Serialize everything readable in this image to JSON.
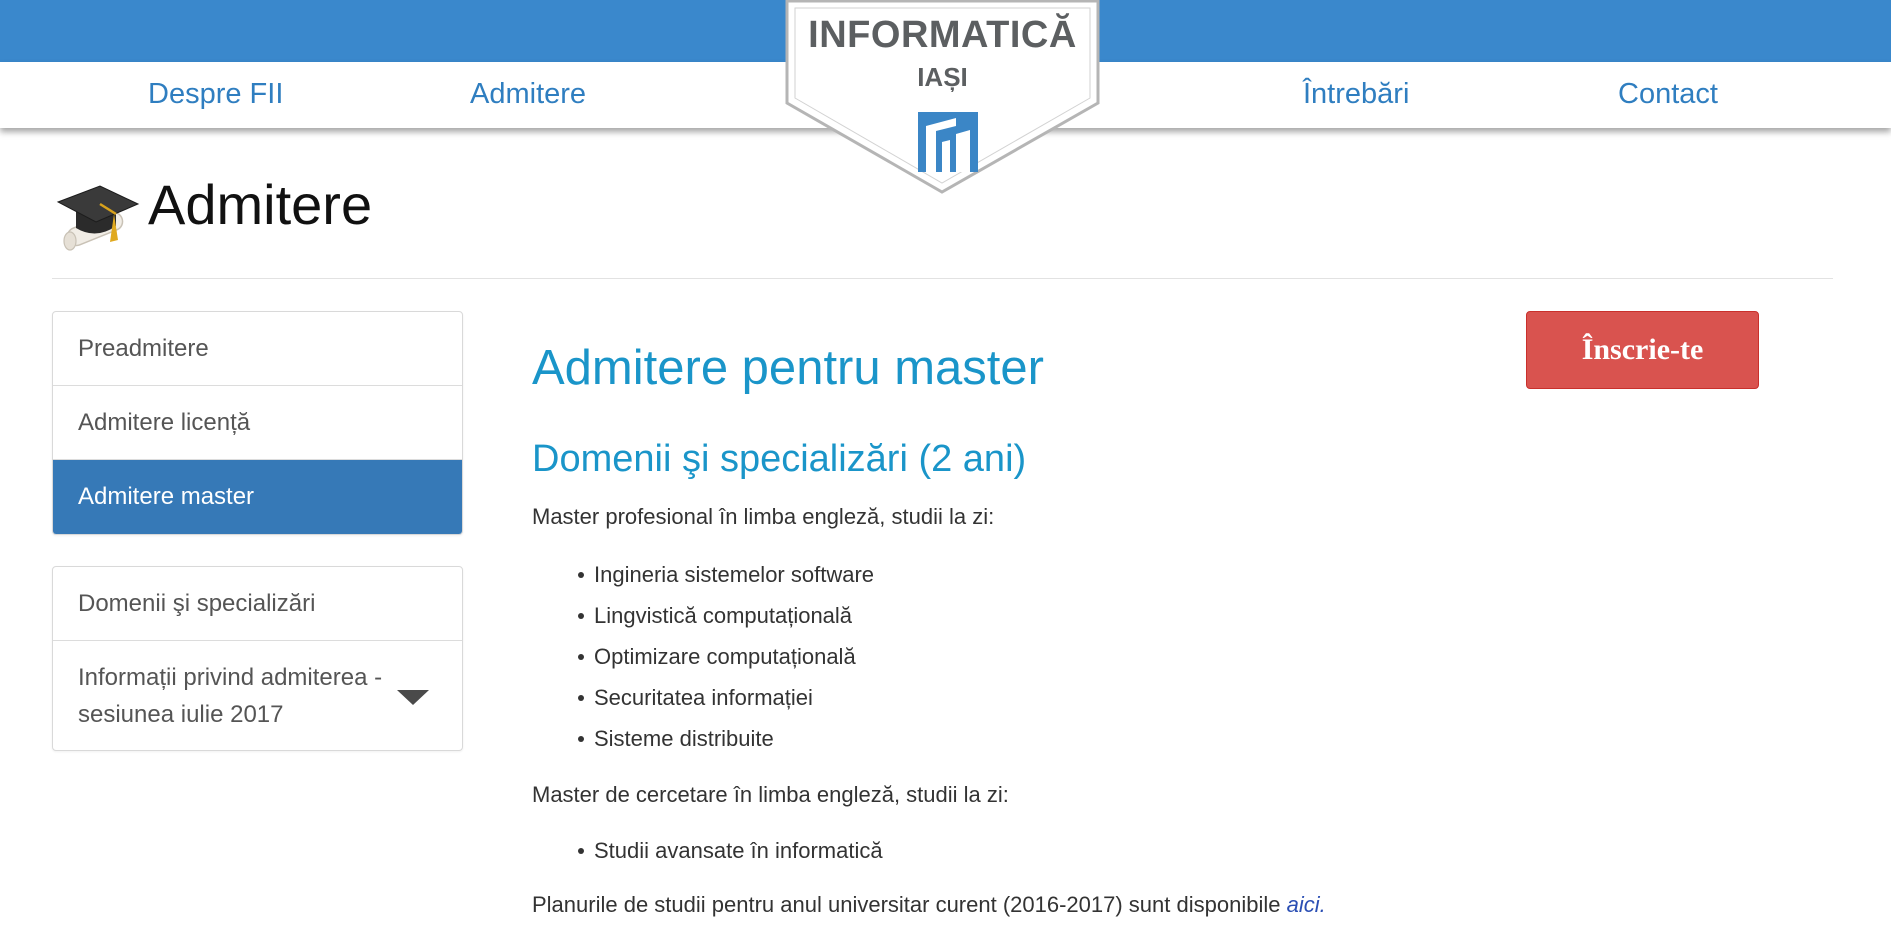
{
  "logo": {
    "line1": "INFORMATICĂ",
    "line2": "IAȘI"
  },
  "nav": {
    "items": [
      "Despre FII",
      "Admitere",
      "Întrebări",
      "Contact"
    ],
    "color": "#2f7ec0",
    "bar_color": "#3a88cc"
  },
  "page": {
    "title": "Admitere",
    "icon": "graduation-cap-icon"
  },
  "sidebar": {
    "menu": [
      {
        "label": "Preadmitere",
        "active": false
      },
      {
        "label": "Admitere licență",
        "active": false
      },
      {
        "label": "Admitere master",
        "active": true
      }
    ],
    "sub": [
      {
        "label": "Domenii şi specializări"
      },
      {
        "label": "Informații privind admiterea - sesiunea iulie 2017",
        "dropdown": true
      }
    ],
    "active_color": "#3679b7"
  },
  "content": {
    "h1": "Admitere pentru master",
    "h2": "Domenii şi specializări (2 ani)",
    "intro1": "Master profesional în limba engleză, studii la zi:",
    "list1": [
      "Ingineria sistemelor software",
      "Lingvistică computațională",
      "Optimizare computațională",
      "Securitatea informației",
      "Sisteme distribuite"
    ],
    "intro2": "Master de cercetare în limba engleză, studii la zi:",
    "list2": [
      "Studii avansate în informatică"
    ],
    "plans_text": "Planurile de studii pentru anul universitar curent (2016-2017) sunt disponibile ",
    "plans_link": "aici."
  },
  "signup": {
    "label": "Înscrie-te",
    "color": "#d9534f"
  }
}
